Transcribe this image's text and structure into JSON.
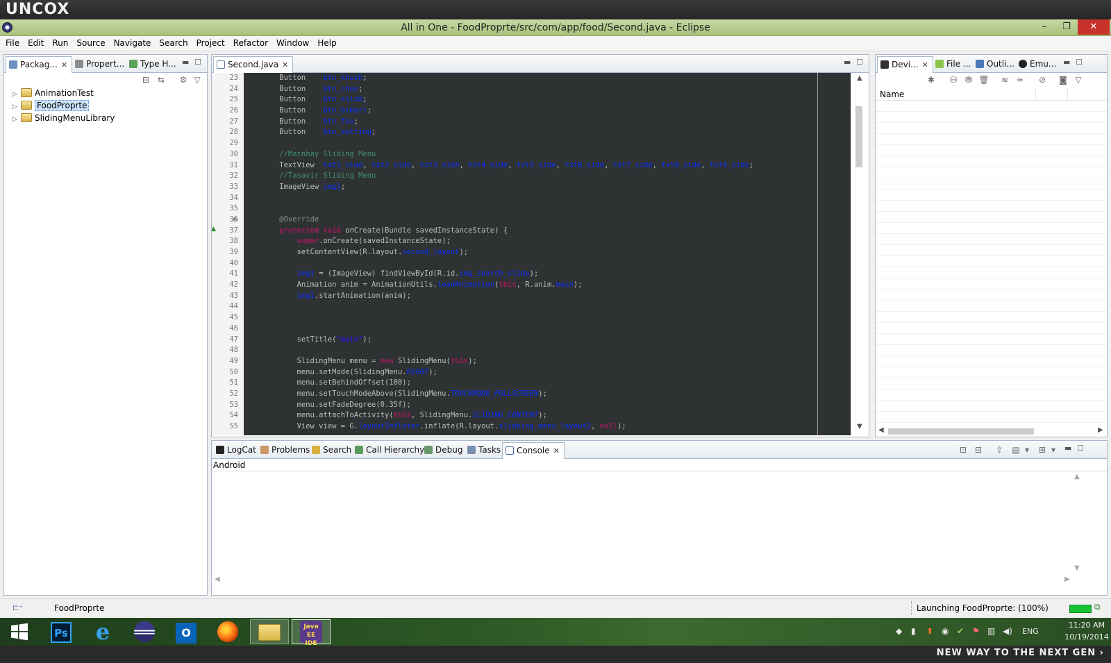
{
  "brand": "UNCOX",
  "window": {
    "title": "All in One - FoodProprte/src/com/app/food/Second.java - Eclipse",
    "minimize": "–",
    "restore": "❐",
    "close": "✕"
  },
  "menu": [
    "File",
    "Edit",
    "Run",
    "Source",
    "Navigate",
    "Search",
    "Project",
    "Refactor",
    "Window",
    "Help"
  ],
  "left_panel": {
    "tabs": [
      {
        "label": "Packag...",
        "active": true,
        "close": "✕"
      },
      {
        "label": "Propert...",
        "active": false
      },
      {
        "label": "Type H...",
        "active": false
      }
    ],
    "tree": [
      {
        "label": "AnimationTest",
        "selected": false
      },
      {
        "label": "FoodProprte",
        "selected": true
      },
      {
        "label": "SlidingMenuLibrary",
        "selected": false
      }
    ]
  },
  "editor": {
    "tab": {
      "label": "Second.java",
      "close": "✕"
    },
    "lines": [
      {
        "n": "23",
        "text": "    Button    btn_khosh;"
      },
      {
        "n": "24",
        "text": "    Button    btn_chay;"
      },
      {
        "n": "25",
        "text": "    Button    btn_eslam;"
      },
      {
        "n": "26",
        "text": "    Button    btn_bimari;"
      },
      {
        "n": "27",
        "text": "    Button    btn_fav;"
      },
      {
        "n": "28",
        "text": "    Button    btn_setting;"
      },
      {
        "n": "29",
        "text": ""
      },
      {
        "n": "30",
        "text": "    //Matnhay Sliding Menu"
      },
      {
        "n": "31",
        "text": "    TextView  txt1_side, txt2_side, txt3_side, txt4_side, txt5_side, txt6_side, txt7_side, txt8_side, txt9_side;"
      },
      {
        "n": "32",
        "text": "    //Tasavir Sliding Menu"
      },
      {
        "n": "33",
        "text": "    ImageView img1;"
      },
      {
        "n": "34",
        "text": ""
      },
      {
        "n": "35",
        "text": ""
      },
      {
        "n": "36",
        "text": "    @Override"
      },
      {
        "n": "37",
        "text": "    protected void onCreate(Bundle savedInstanceState) {"
      },
      {
        "n": "38",
        "text": "        super.onCreate(savedInstanceState);"
      },
      {
        "n": "39",
        "text": "        setContentView(R.layout.second_layout);"
      },
      {
        "n": "40",
        "text": ""
      },
      {
        "n": "41",
        "text": "        img1 = (ImageView) findViewById(R.id.img_search_slide);"
      },
      {
        "n": "42",
        "text": "        Animation anim = AnimationUtils.loadAnimation(this, R.anim.main);"
      },
      {
        "n": "43",
        "text": "        img1.startAnimation(anim);"
      },
      {
        "n": "44",
        "text": ""
      },
      {
        "n": "45",
        "text": ""
      },
      {
        "n": "46",
        "text": ""
      },
      {
        "n": "47",
        "text": "        setTitle(\"main\");"
      },
      {
        "n": "48",
        "text": ""
      },
      {
        "n": "49",
        "text": "        SlidingMenu menu = new SlidingMenu(this);"
      },
      {
        "n": "50",
        "text": "        menu.setMode(SlidingMenu.RIGHT);"
      },
      {
        "n": "51",
        "text": "        menu.setBehindOffset(100);"
      },
      {
        "n": "52",
        "text": "        menu.setTouchModeAbove(SlidingMenu.TOUCHMODE_FULLSCREEN);"
      },
      {
        "n": "53",
        "text": "        menu.setFadeDegree(0.35f);"
      },
      {
        "n": "54",
        "text": "        menu.attachToActivity(this, SlidingMenu.SLIDING_CONTENT);"
      },
      {
        "n": "55",
        "text": "        View view = G.layoutInflater.inflate(R.layout.slideing_menu_layout2, null);"
      }
    ]
  },
  "right_panel": {
    "tabs": [
      {
        "label": "Devi...",
        "active": true,
        "close": "✕"
      },
      {
        "label": "File ...",
        "active": false
      },
      {
        "label": "Outli...",
        "active": false
      },
      {
        "label": "Emu...",
        "active": false
      }
    ],
    "column_header": "Name"
  },
  "bottom_panel": {
    "tabs": [
      {
        "label": "LogCat",
        "active": false
      },
      {
        "label": "Problems",
        "active": false
      },
      {
        "label": "Search",
        "active": false
      },
      {
        "label": "Call Hierarchy",
        "active": false
      },
      {
        "label": "Debug",
        "active": false
      },
      {
        "label": "Tasks",
        "active": false
      },
      {
        "label": "Console",
        "active": true,
        "close": "✕"
      }
    ],
    "console_title": "Android"
  },
  "status": {
    "selected_project": "FoodProprte",
    "progress_text": "Launching FoodProprte: (100%)",
    "progress_percent": 100
  },
  "taskbar": {
    "apps": [
      "start-button",
      "photoshop",
      "internet-explorer",
      "eclipse",
      "outlook",
      "firefox",
      "file-explorer",
      "java-ee-ide"
    ],
    "ps_label": "Ps",
    "ol_label": "O",
    "ee_label": "Java EE IDE",
    "lang": "ENG",
    "time": "11:20 AM",
    "date": "10/19/2014"
  },
  "slogan": "NEW WAY TO THE NEXT GEN ›"
}
